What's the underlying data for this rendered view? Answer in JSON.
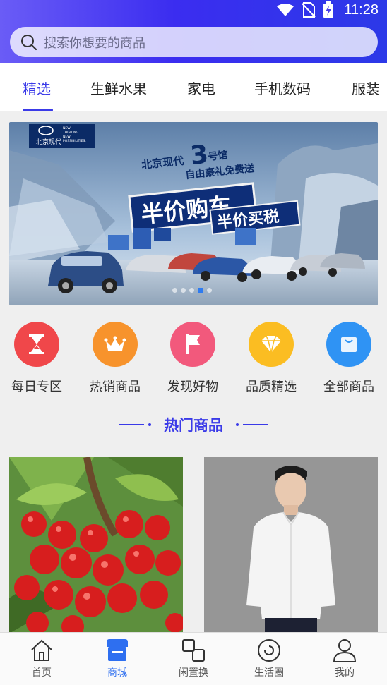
{
  "status": {
    "time": "11:28",
    "icons": [
      "wifi-icon",
      "no-sim-icon",
      "battery-charging-icon"
    ]
  },
  "search": {
    "placeholder": "搜索你想要的商品"
  },
  "tabs": [
    {
      "label": "精选",
      "active": true
    },
    {
      "label": "生鲜水果",
      "active": false
    },
    {
      "label": "家电",
      "active": false
    },
    {
      "label": "手机数码",
      "active": false
    },
    {
      "label": "服装",
      "active": false
    }
  ],
  "banner": {
    "brand": "北京现代",
    "brand_tag": "NEW THINKING. NEW POSSIBILITIES.",
    "line1": "北京现代",
    "number": "3",
    "line1_suffix": "号馆",
    "line2": "自由豪礼免费送",
    "headline": "半价购车",
    "subheadline": "半价买税",
    "pages": 5,
    "current_page": 4
  },
  "entries": [
    {
      "label": "每日专区",
      "icon": "hourglass-icon",
      "color": "#f0474a"
    },
    {
      "label": "热销商品",
      "icon": "crown-icon",
      "color": "#f7932c"
    },
    {
      "label": "发现好物",
      "icon": "flag-icon",
      "color": "#f2597c"
    },
    {
      "label": "品质精选",
      "icon": "diamond-icon",
      "color": "#fbbd22"
    },
    {
      "label": "全部商品",
      "icon": "bag-icon",
      "color": "#2f93f4"
    }
  ],
  "section": {
    "title": "热门商品"
  },
  "products": [
    {
      "name": "cherries",
      "image": "cherry-image"
    },
    {
      "name": "white-shirt",
      "image": "shirt-model-image"
    }
  ],
  "bottom_nav": [
    {
      "label": "首页",
      "icon": "home-icon",
      "active": false
    },
    {
      "label": "商城",
      "icon": "store-icon",
      "active": true
    },
    {
      "label": "闲置换",
      "icon": "swap-icon",
      "active": false
    },
    {
      "label": "生活圈",
      "icon": "circle-icon",
      "active": false
    },
    {
      "label": "我的",
      "icon": "user-icon",
      "active": false
    }
  ],
  "colors": {
    "accent": "#3a3ae8",
    "nav_active": "#2e6ff0"
  }
}
